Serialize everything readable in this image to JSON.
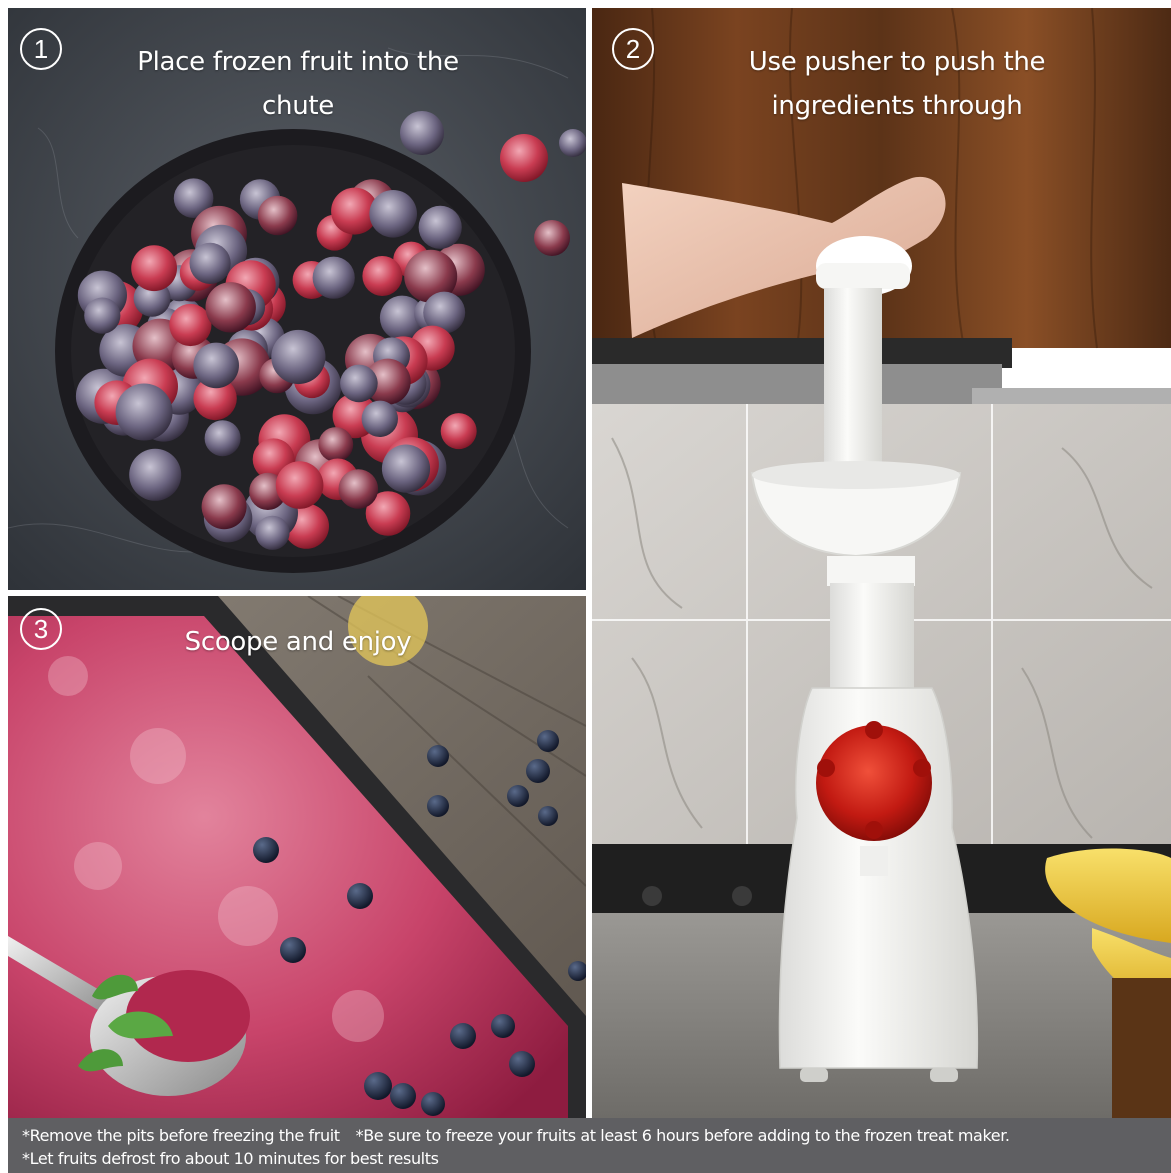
{
  "steps": [
    {
      "number": "1",
      "caption": "Place frozen fruit into the chute"
    },
    {
      "number": "2",
      "caption_line1": "Use pusher to push the",
      "caption_line2": "ingredients through"
    },
    {
      "number": "3",
      "caption": "Scoope and enjoy"
    }
  ],
  "footnotes": {
    "line1_part1": "*Remove the pits before freezing the fruit",
    "line1_part2": "*Be sure to freeze your fruits at least 6 hours before adding to the frozen treat maker.",
    "line2": "*Let fruits defrost fro about 10 minutes for best results"
  },
  "colors": {
    "background": "#ffffff",
    "caption_text": "#ffffff",
    "stone_gray": "#4a4e55",
    "machine_white": "#f4f4f2",
    "knob_red": "#c21a12",
    "wood_brown": "#6a3a1c",
    "sorbet_pink": "#c8446a",
    "banana_yellow": "#f2cf3a"
  }
}
